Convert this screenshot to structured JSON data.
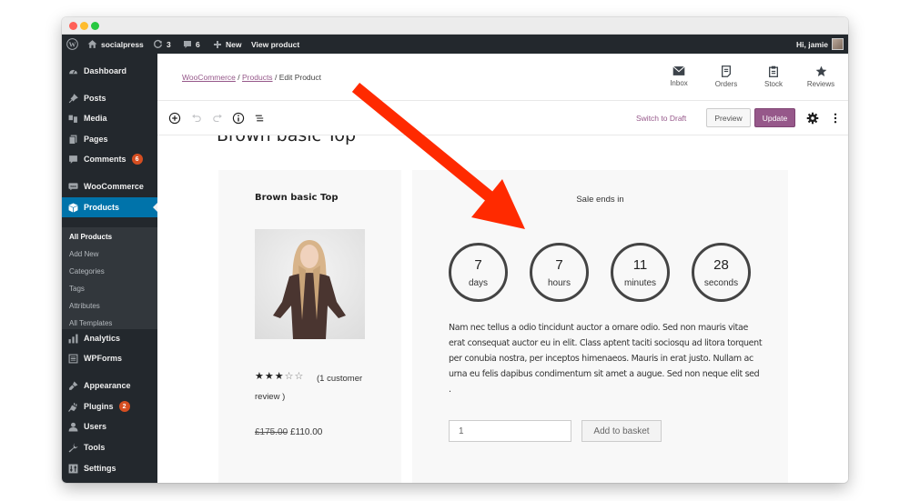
{
  "adminbar": {
    "site_name": "socialpress",
    "updates_count": "3",
    "comments_count": "6",
    "new_label": "New",
    "view_product_label": "View product",
    "greeting": "Hi, jamie"
  },
  "sidebar": {
    "items": [
      {
        "label": "Dashboard",
        "icon": "dashboard-icon"
      },
      {
        "label": "Posts",
        "icon": "pin-icon"
      },
      {
        "label": "Media",
        "icon": "media-icon"
      },
      {
        "label": "Pages",
        "icon": "pages-icon"
      },
      {
        "label": "Comments",
        "icon": "comment-icon",
        "badge": "6"
      },
      {
        "label": "WooCommerce",
        "icon": "woo-icon"
      },
      {
        "label": "Products",
        "icon": "box-icon",
        "active": true
      },
      {
        "label": "Analytics",
        "icon": "bar-chart-icon"
      },
      {
        "label": "WPForms",
        "icon": "forms-icon"
      },
      {
        "label": "Appearance",
        "icon": "brush-icon"
      },
      {
        "label": "Plugins",
        "icon": "plug-icon",
        "badge": "2"
      },
      {
        "label": "Users",
        "icon": "user-icon"
      },
      {
        "label": "Tools",
        "icon": "wrench-icon"
      },
      {
        "label": "Settings",
        "icon": "settings-icon"
      }
    ],
    "submenu": [
      "All Products",
      "Add New",
      "Categories",
      "Tags",
      "Attributes",
      "All Templates"
    ]
  },
  "header": {
    "breadcrumb": {
      "first": "WooCommerce",
      "second": "Products",
      "current": "Edit Product",
      "sep": "/"
    },
    "actions": [
      {
        "label": "Inbox",
        "icon": "inbox-icon"
      },
      {
        "label": "Orders",
        "icon": "orders-icon"
      },
      {
        "label": "Stock",
        "icon": "stock-icon"
      },
      {
        "label": "Reviews",
        "icon": "star-icon"
      }
    ]
  },
  "toolbar": {
    "switch_to_draft": "Switch to Draft",
    "preview": "Preview",
    "update": "Update"
  },
  "editor": {
    "post_title": "Brown basic Top"
  },
  "product": {
    "title": "Brown basic Top",
    "rating": 3,
    "rating_max": 5,
    "review_text": "(1 customer review )",
    "price_old": "£175.00",
    "price_new": "£110.00",
    "sale_label": "Sale ends in",
    "countdown": [
      {
        "value": "7",
        "unit": "days"
      },
      {
        "value": "7",
        "unit": "hours"
      },
      {
        "value": "11",
        "unit": "minutes"
      },
      {
        "value": "28",
        "unit": "seconds"
      }
    ],
    "description": "Nam nec tellus a odio tincidunt auctor a ornare odio. Sed non mauris vitae erat consequat auctor eu in elit. Class aptent taciti sociosqu ad litora torquent per conubia nostra, per inceptos himenaeos. Mauris in erat justo. Nullam ac urna eu felis dapibus condimentum sit amet a augue. Sed non neque elit sed .",
    "quantity": "1",
    "add_to_basket": "Add to basket"
  },
  "annotation": {
    "arrow_color": "#ff2a00"
  },
  "colors": {
    "admin_dark": "#23282d",
    "wp_blue": "#0073aa",
    "woo_purple": "#96588a",
    "badge_orange": "#d54e21"
  }
}
